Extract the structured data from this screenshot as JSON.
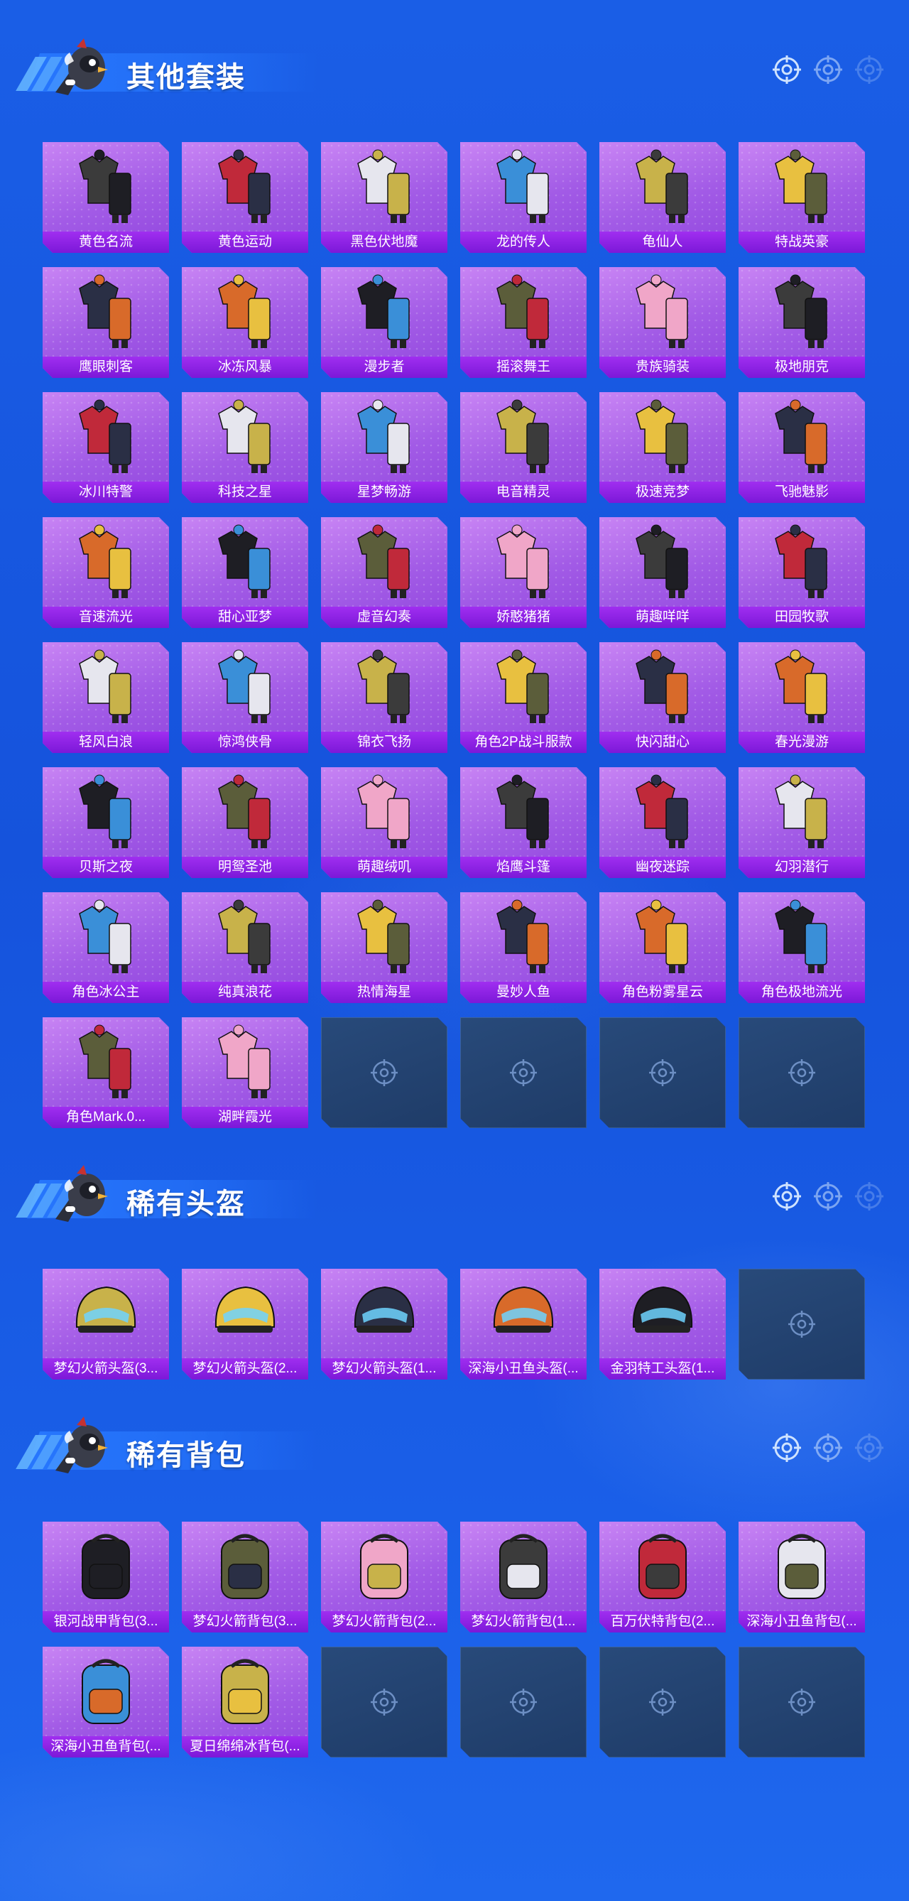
{
  "sections": [
    {
      "title": "其他套装",
      "items": [
        "黄色名流",
        "黄色运动",
        "黑色伏地魔",
        "龙的传人",
        "龟仙人",
        "特战英豪",
        "鹰眼刺客",
        "冰冻风暴",
        "漫步者",
        "摇滚舞王",
        "贵族骑装",
        "极地朋克",
        "冰川特警",
        "科技之星",
        "星梦畅游",
        "电音精灵",
        "极速竞梦",
        "飞驰魅影",
        "音速流光",
        "甜心亚梦",
        "虚音幻奏",
        "娇憨猪猪",
        "萌趣咩咩",
        "田园牧歌",
        "轻风白浪",
        "惊鸿侠骨",
        "锦衣飞扬",
        "角色2P战斗服款",
        "快闪甜心",
        "春光漫游",
        "贝斯之夜",
        "明鸳圣池",
        "萌趣绒叽",
        "焰鹰斗篷",
        "幽夜迷踪",
        "幻羽潜行",
        "角色冰公主",
        "纯真浪花",
        "热情海星",
        "曼妙人鱼",
        "角色粉雾星云",
        "角色极地流光",
        "角色Mark.0...",
        "湖畔霞光"
      ],
      "empty_slots": 4
    },
    {
      "title": "稀有头盔",
      "items": [
        "梦幻火箭头盔(3...",
        "梦幻火箭头盔(2...",
        "梦幻火箭头盔(1...",
        "深海小丑鱼头盔(...",
        "金羽特工头盔(1..."
      ],
      "empty_slots": 1
    },
    {
      "title": "稀有背包",
      "items": [
        "银河战甲背包(3...",
        "梦幻火箭背包(3...",
        "梦幻火箭背包(2...",
        "梦幻火箭背包(1...",
        "百万伏特背包(2...",
        "深海小丑鱼背包(...",
        "深海小丑鱼背包(...",
        "夏日绵绵冰背包(..."
      ],
      "empty_slots": 4
    }
  ],
  "colors": {
    "card_purple": "#a25be6",
    "label_purple": "#8a22e4",
    "empty_slot": "#243f6c",
    "background_blue": "#1553dc"
  },
  "icons": {
    "header_mascot": "chicken-mascot-icon",
    "header_targets": "crosshair-target-icon",
    "empty_slot": "crosshair-target-icon"
  }
}
